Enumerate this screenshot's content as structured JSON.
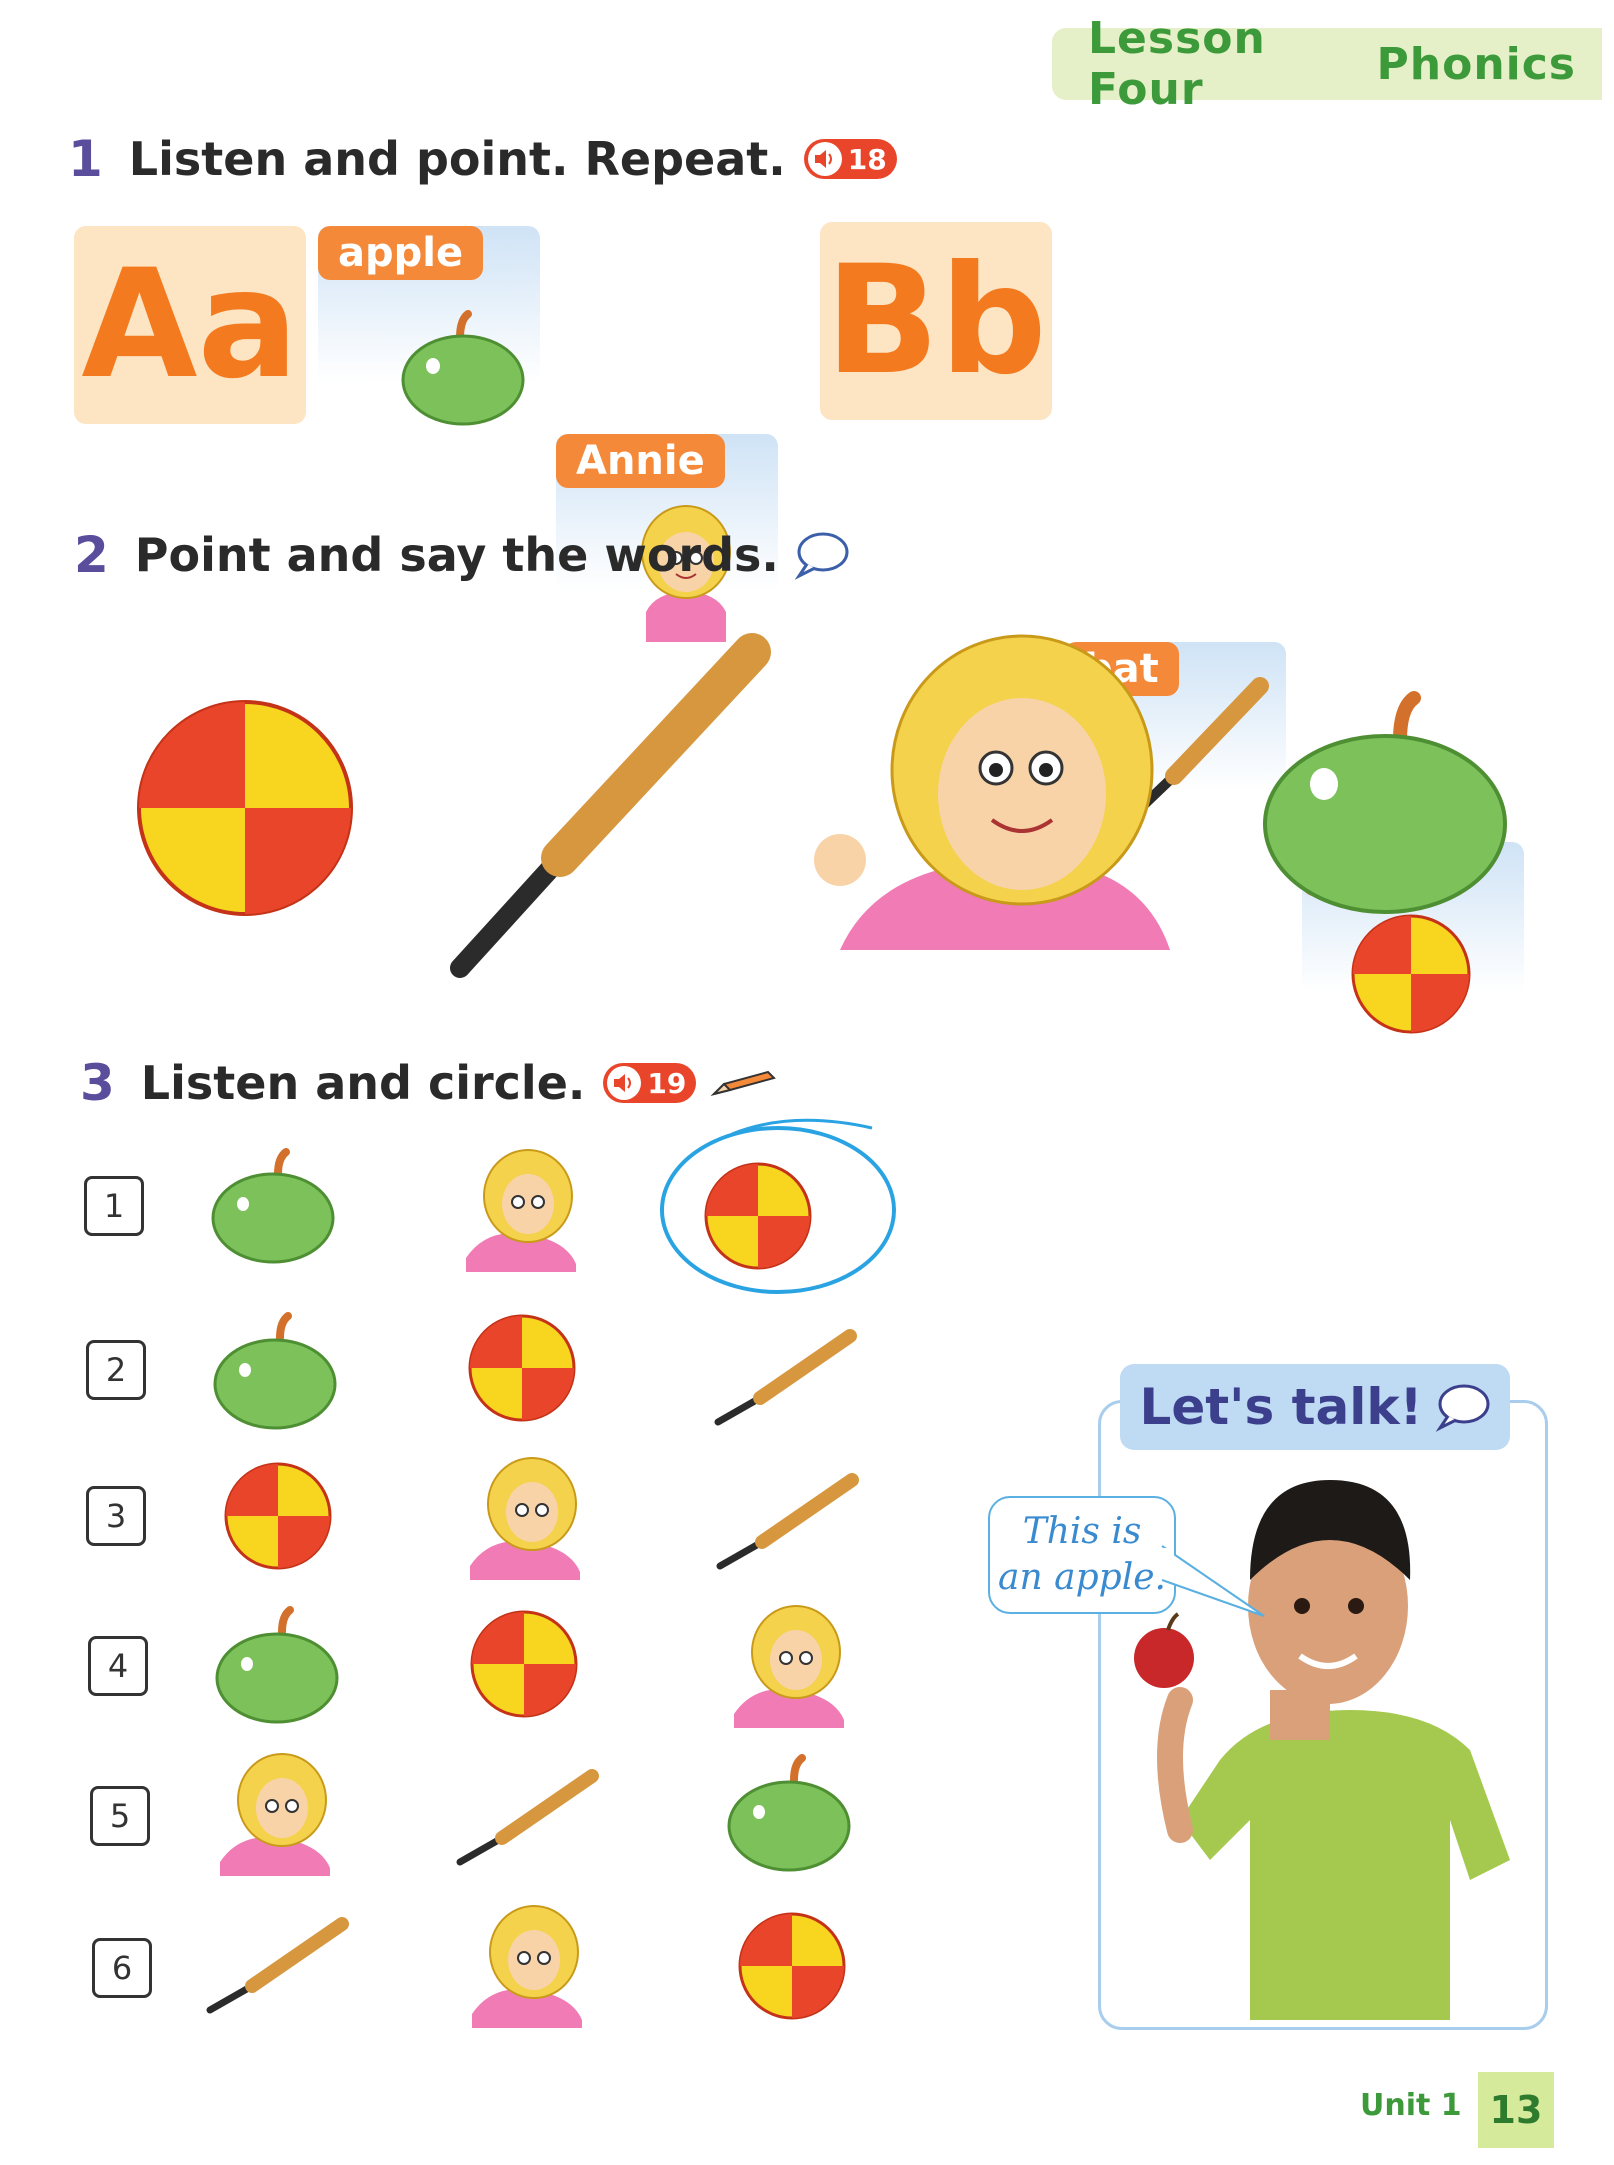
{
  "header": {
    "lesson": "Lesson Four",
    "topic": "Phonics"
  },
  "section1": {
    "number": "1",
    "instruction": "Listen and point. Repeat.",
    "track": "18",
    "cards": [
      {
        "letter": "Aa"
      },
      {
        "word": "apple",
        "icon": "apple-icon"
      },
      {
        "word": "Annie",
        "icon": "girl-icon"
      },
      {
        "letter": "Bb"
      },
      {
        "word": "bat",
        "icon": "bat-icon"
      },
      {
        "word": "ball",
        "icon": "ball-icon"
      }
    ]
  },
  "section2": {
    "number": "2",
    "instruction": "Point and say the words."
  },
  "section3": {
    "number": "3",
    "instruction": "Listen and circle.",
    "track": "19",
    "rows": [
      {
        "num": "1",
        "items": [
          "apple",
          "girl",
          "ball"
        ],
        "circled": 2
      },
      {
        "num": "2",
        "items": [
          "apple",
          "ball",
          "bat"
        ]
      },
      {
        "num": "3",
        "items": [
          "ball",
          "girl",
          "bat"
        ]
      },
      {
        "num": "4",
        "items": [
          "apple",
          "ball",
          "girl"
        ]
      },
      {
        "num": "5",
        "items": [
          "girl",
          "bat",
          "apple"
        ]
      },
      {
        "num": "6",
        "items": [
          "bat",
          "girl",
          "ball"
        ]
      }
    ]
  },
  "talk": {
    "title": "Let's talk!",
    "bubble_line1": "This is",
    "bubble_line2": "an apple."
  },
  "footer": {
    "unit": "Unit 1",
    "page": "13"
  },
  "colors": {
    "accent_green": "#3d9a3a",
    "section_num": "#5a4e9c",
    "orange": "#f47a1f",
    "audio_red": "#e8452a"
  }
}
